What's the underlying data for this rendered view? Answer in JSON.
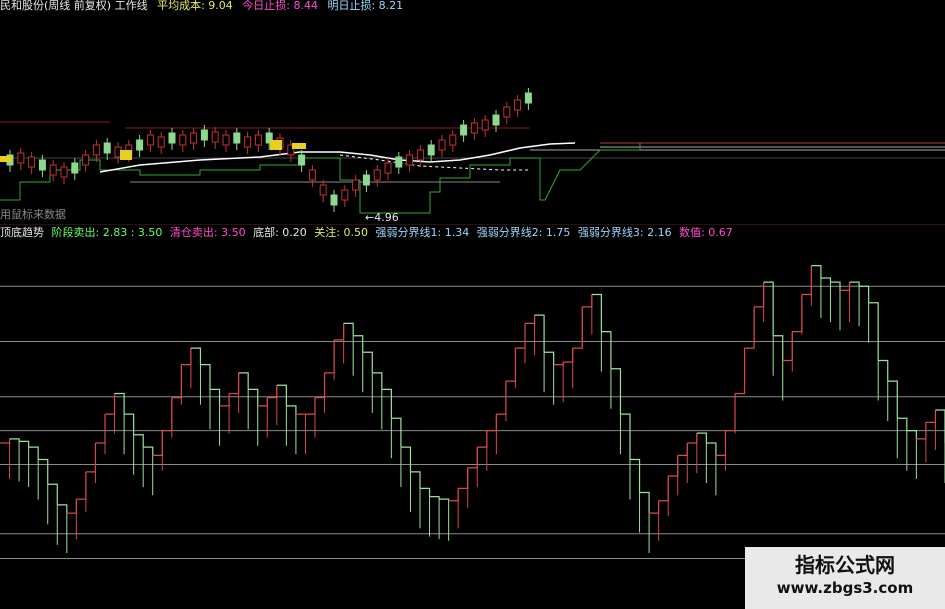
{
  "topbar": {
    "items": [
      {
        "text": "民和股份(周线 前复权) 工作线",
        "color": "#e8e8e8"
      },
      {
        "text": "平均成本: 9.04",
        "color": "#e8e86a"
      },
      {
        "text": "今日止损: 8.44",
        "color": "#ff4fd0"
      },
      {
        "text": "明日止损: 8.21",
        "color": "#9ad8ff"
      }
    ]
  },
  "price_panel": {
    "hint": "用鼠标来数据",
    "low_marker": "←4.96"
  },
  "indicator_bar": {
    "items": [
      {
        "text": "顶底趋势",
        "color": "#e8e8e8"
      },
      {
        "text": "阶段卖出: 2.83 : 3.50",
        "color": "#66ff66"
      },
      {
        "text": "清仓卖出: 3.50",
        "color": "#ff4fd0"
      },
      {
        "text": "底部: 0.20",
        "color": "#e8e8e8"
      },
      {
        "text": "关注: 0.50",
        "color": "#e8e86a"
      },
      {
        "text": "强弱分界线1: 1.34",
        "color": "#9ad8ff"
      },
      {
        "text": "强弱分界线2: 1.75",
        "color": "#9ad8ff"
      },
      {
        "text": "强弱分界线3: 2.16",
        "color": "#9ad8ff"
      },
      {
        "text": "数值: 0.67",
        "color": "#ff4fd0"
      }
    ]
  },
  "watermark": {
    "title": "指标公式网",
    "url": "www.zbgs3.com"
  },
  "colors": {
    "up": "#c83232",
    "down": "#8fd88f",
    "rising_line": "#d94a4a",
    "falling_line": "#9be39b",
    "reference_line": "#8a8a8a",
    "avg_line": "#ffffff"
  },
  "chart_data": {
    "type": "line",
    "title": "顶底趋势",
    "series": [
      {
        "values": [
          1.6,
          1.65,
          1.62,
          1.55,
          1.4,
          1.1,
          0.85,
          0.75,
          0.92,
          1.25,
          1.6,
          1.95,
          2.2,
          1.95,
          1.7,
          1.55,
          1.45,
          1.75,
          2.15,
          2.55,
          2.75,
          2.55,
          2.25,
          2.05,
          2.2,
          2.45,
          2.25,
          2.05,
          2.15,
          2.3,
          2.05,
          1.95,
          1.95,
          2.15,
          2.45,
          2.85,
          3.05,
          2.9,
          2.7,
          2.45,
          2.25,
          1.9,
          1.55,
          1.25,
          1.05,
          0.95,
          0.92,
          0.9,
          1.05,
          1.3,
          1.55,
          1.75,
          1.95,
          2.35,
          2.75,
          3.05,
          3.15,
          2.7,
          2.55,
          2.58,
          2.75,
          3.25,
          3.4,
          2.95,
          2.5,
          1.95,
          1.4,
          1.0,
          0.75,
          0.9,
          1.2,
          1.45,
          1.6,
          1.72,
          1.6,
          1.45,
          1.75,
          2.2,
          2.75,
          3.25,
          3.55,
          2.9,
          2.6,
          2.95,
          3.4,
          3.75,
          3.6,
          3.55,
          3.45,
          3.55,
          3.5,
          3.3,
          2.6,
          2.35,
          1.9,
          1.75,
          1.65,
          1.85,
          2.0,
          1.6
        ]
      }
    ],
    "ylim": [
      0,
      4
    ],
    "reference_lines": [
      2.83,
      3.5,
      0.2,
      0.5,
      1.34,
      1.75,
      2.16
    ]
  }
}
